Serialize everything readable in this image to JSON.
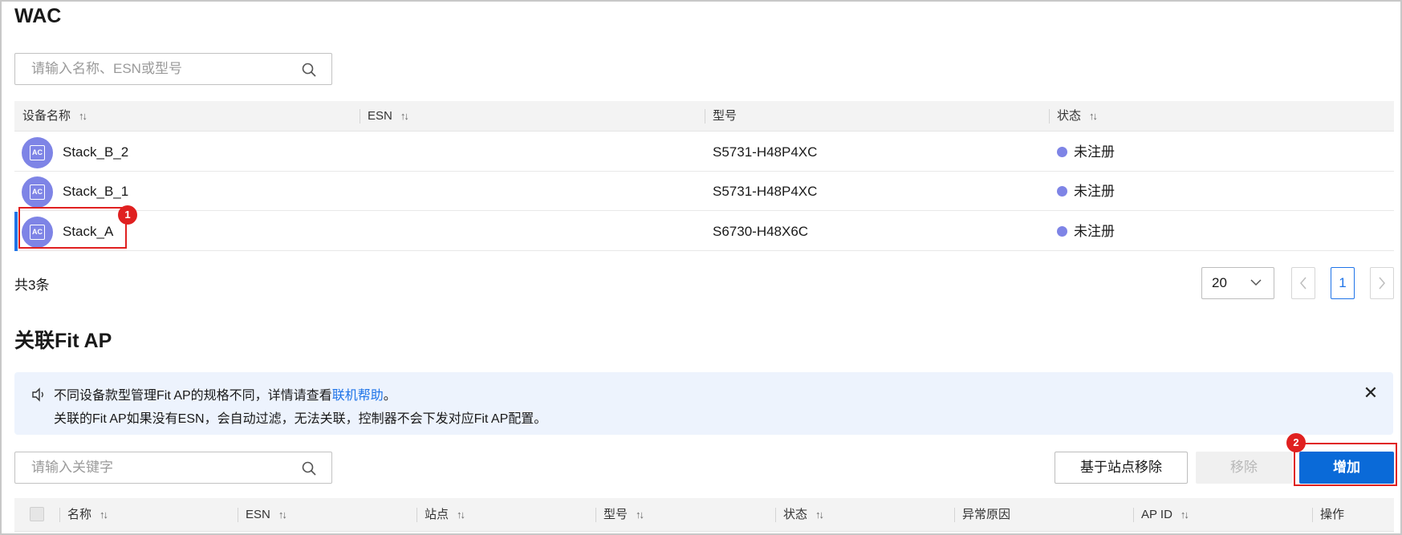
{
  "wac": {
    "title": "WAC",
    "search_placeholder": "请输入名称、ESN或型号",
    "columns": [
      "设备名称",
      "ESN",
      "型号",
      "状态"
    ],
    "sort_glyph": "↑↓",
    "rows": [
      {
        "name": "Stack_B_2",
        "esn": "",
        "model": "S5731-H48P4XC",
        "status": "未注册",
        "icon_label": "AC"
      },
      {
        "name": "Stack_B_1",
        "esn": "",
        "model": "S5731-H48P4XC",
        "status": "未注册",
        "icon_label": "AC"
      },
      {
        "name": "Stack_A",
        "esn": "",
        "model": "S6730-H48X6C",
        "status": "未注册",
        "icon_label": "AC"
      }
    ],
    "total": "共3条",
    "page_size": "20",
    "current_page": "1"
  },
  "badges": {
    "one": "1",
    "two": "2"
  },
  "fitap": {
    "title": "关联Fit AP",
    "notice_line1_pre": "不同设备款型管理Fit AP的规格不同，详情请查看",
    "notice_link": "联机帮助",
    "notice_line1_post": "。",
    "notice_line2": "关联的Fit AP如果没有ESN，会自动过滤，无法关联，控制器不会下发对应Fit AP配置。",
    "search_placeholder": "请输入关键字",
    "buttons": {
      "remove_by_site": "基于站点移除",
      "remove": "移除",
      "add": "增加"
    },
    "columns": [
      "名称",
      "ESN",
      "站点",
      "型号",
      "状态",
      "异常原因",
      "AP ID",
      "操作"
    ]
  },
  "icons": [
    "search-icon",
    "sort-icon",
    "device-ac-icon",
    "chevron-down-icon",
    "chevron-left-icon",
    "chevron-right-icon",
    "speaker-icon",
    "close-icon"
  ],
  "colors": {
    "primary": "#0a6ad8",
    "status_unregistered": "#7e84e6",
    "highlight": "#e02020",
    "notice_bg": "#edf3fd"
  }
}
